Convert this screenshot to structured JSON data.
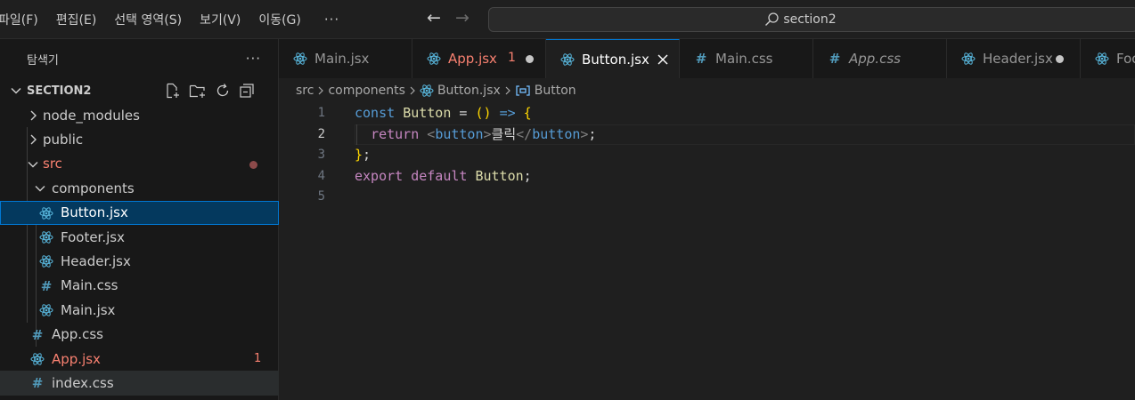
{
  "menu": [
    "파일(F)",
    "편집(E)",
    "선택 영역(S)",
    "보기(V)",
    "이동(G)"
  ],
  "menu_more": "···",
  "nav": {
    "back": "←",
    "forward": "→"
  },
  "search": {
    "text": "section2"
  },
  "sidebar": {
    "title": "탐색기",
    "more": "···",
    "section": "SECTION2",
    "items": [
      {
        "label": "node_modules"
      },
      {
        "label": "public"
      },
      {
        "label": "src"
      },
      {
        "label": "components"
      },
      {
        "label": "Button.jsx"
      },
      {
        "label": "Footer.jsx"
      },
      {
        "label": "Header.jsx"
      },
      {
        "label": "Main.css"
      },
      {
        "label": "Main.jsx"
      },
      {
        "label": "App.css"
      },
      {
        "label": "App.jsx",
        "badge": "1"
      },
      {
        "label": "index.css"
      }
    ]
  },
  "tabs": [
    {
      "label": "Main.jsx",
      "icon": "react-icon"
    },
    {
      "label": "App.jsx",
      "icon": "react-icon",
      "badge": "1"
    },
    {
      "label": "Button.jsx",
      "icon": "react-icon"
    },
    {
      "label": "Main.css",
      "icon": "hash-icon"
    },
    {
      "label": "App.css",
      "icon": "hash-icon"
    },
    {
      "label": "Header.jsx",
      "icon": "react-icon"
    },
    {
      "label": "Foo",
      "icon": "react-icon"
    }
  ],
  "breadcrumb": [
    "src",
    "components",
    "Button.jsx",
    "Button"
  ],
  "editor": {
    "line_numbers": [
      "1",
      "2",
      "3",
      "4",
      "5"
    ],
    "line1": [
      "const",
      "Button",
      "=",
      "(",
      ")",
      "=>",
      "{"
    ],
    "line2": [
      "return",
      "<",
      "button",
      ">",
      "클릭",
      "</",
      "button",
      ">",
      ";"
    ],
    "line3": [
      "}",
      ";"
    ],
    "line4": [
      "export",
      "default",
      "Button",
      ";"
    ]
  },
  "colors": {
    "accent": "#0078d4",
    "error": "#f88070",
    "react": "#58b6dc",
    "css": "#519aba"
  }
}
